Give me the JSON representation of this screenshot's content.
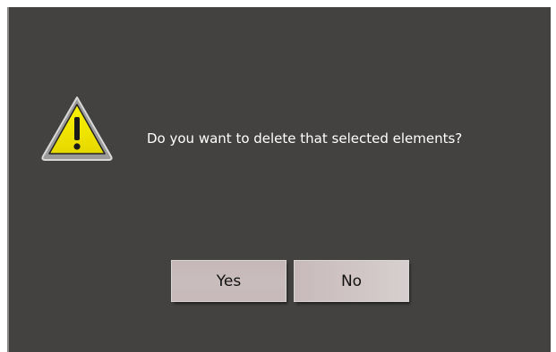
{
  "dialog": {
    "icon": "warning-icon",
    "message": "Do you want to delete that selected elements?",
    "buttons": {
      "yes_label": "Yes",
      "no_label": "No"
    }
  },
  "colors": {
    "background": "#434240",
    "text": "#ffffff",
    "button": "#c9bcbd",
    "warning_yellow": "#f2e400"
  }
}
